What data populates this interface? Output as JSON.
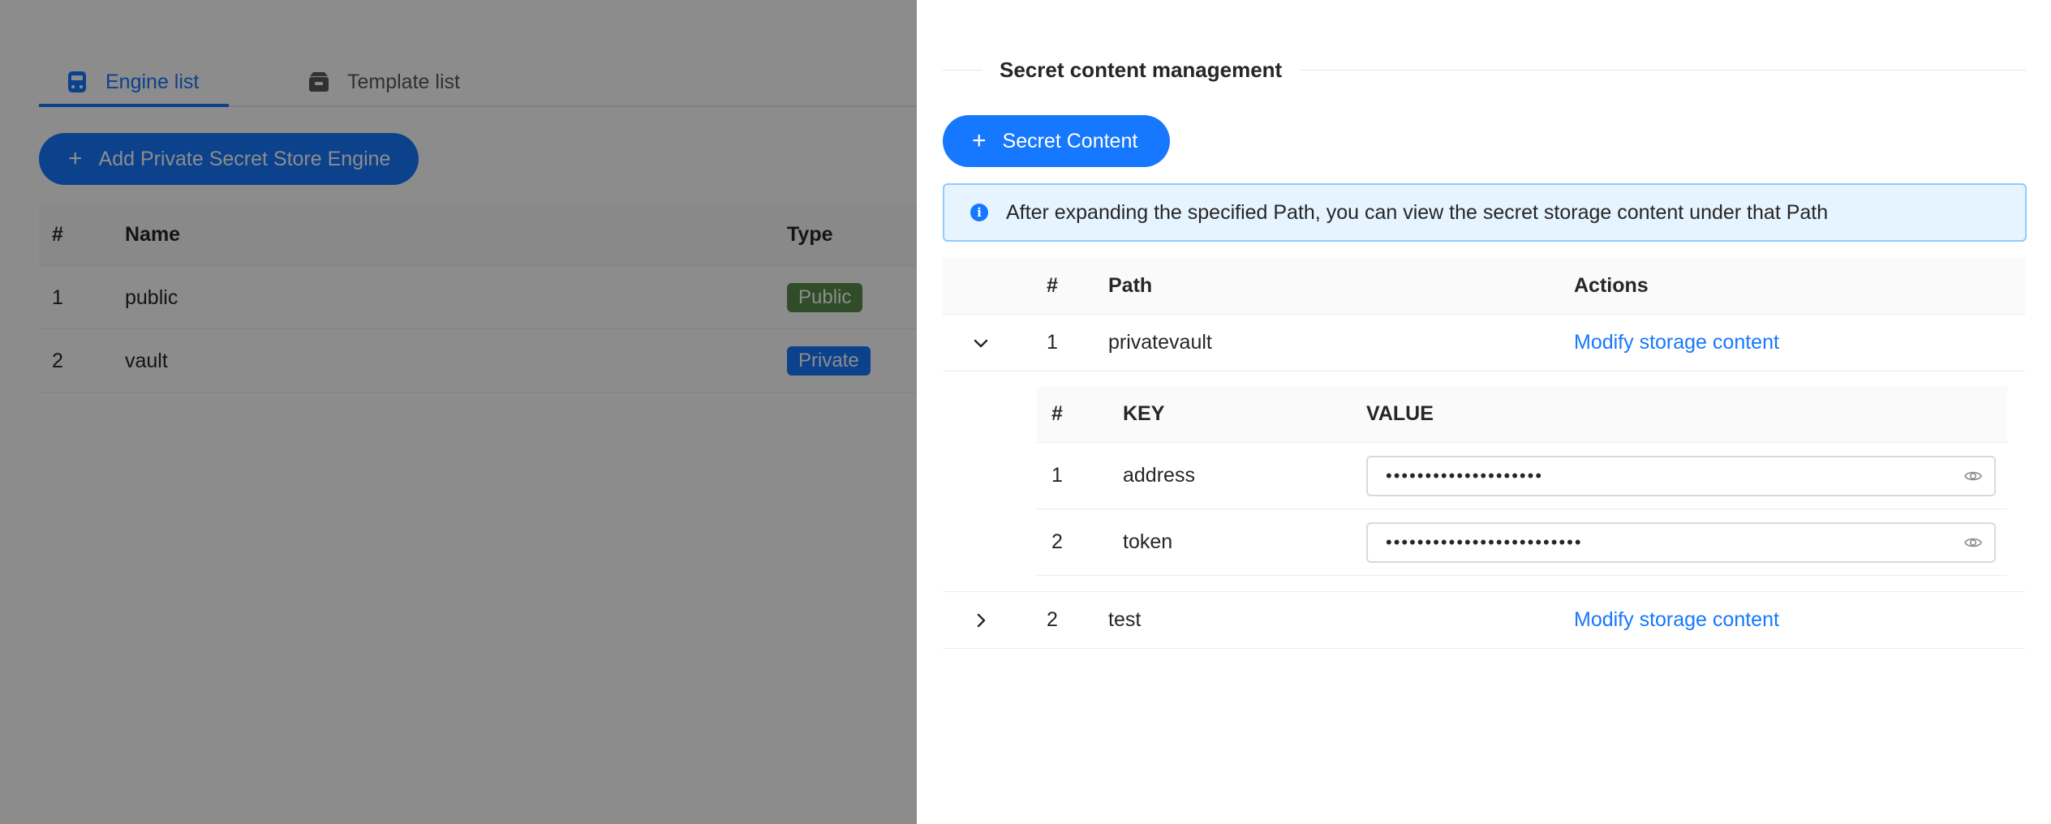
{
  "background": {
    "tabs": [
      {
        "label": "Engine list",
        "icon": "database-icon",
        "active": true
      },
      {
        "label": "Template list",
        "icon": "inbox-icon",
        "active": false
      }
    ],
    "add_button_label": "Add Private Secret Store Engine",
    "table": {
      "columns": [
        "#",
        "Name",
        "Type"
      ],
      "rows": [
        {
          "index": "1",
          "name": "public",
          "type": "Public"
        },
        {
          "index": "2",
          "name": "vault",
          "type": "Private"
        }
      ]
    }
  },
  "drawer": {
    "section_title": "Secret content management",
    "add_button_label": "Secret Content",
    "alert_text": "After expanding the specified Path, you can view the secret storage content under that Path",
    "table": {
      "columns": [
        "#",
        "Path",
        "Actions"
      ],
      "rows": [
        {
          "index": "1",
          "path": "privatevault",
          "action": "Modify storage content",
          "expanded": true
        },
        {
          "index": "2",
          "path": "test",
          "action": "Modify storage content",
          "expanded": false
        }
      ]
    },
    "inner_table": {
      "columns": [
        "#",
        "KEY",
        "VALUE"
      ],
      "rows": [
        {
          "index": "1",
          "key": "address",
          "value_mask": "••••••••••••••••••••"
        },
        {
          "index": "2",
          "key": "token",
          "value_mask": "•••••••••••••••••••••••••"
        }
      ]
    }
  },
  "colors": {
    "primary": "#1677ff",
    "tag_public": "#5a8a4a",
    "alert_bg": "#e6f4ff",
    "alert_border": "#91caff",
    "mask": "rgba(0,0,0,0.45)"
  }
}
